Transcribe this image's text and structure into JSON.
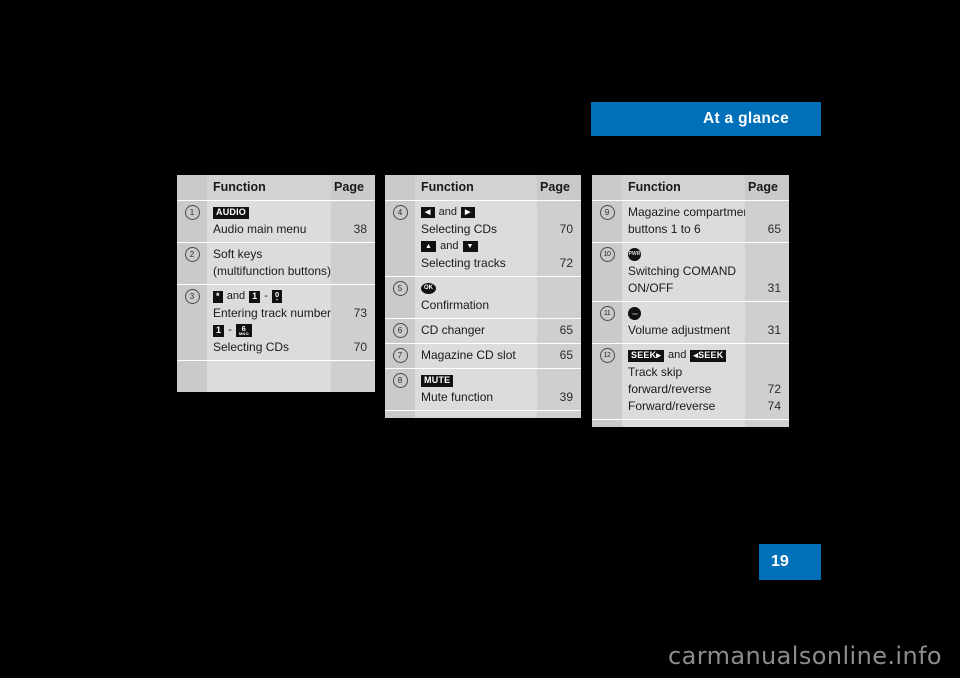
{
  "header": {
    "title": "At a glance",
    "accent_color": "#0070b8"
  },
  "page_marker": {
    "number": "19",
    "accent_color": "#0070b8"
  },
  "watermark": {
    "text": "carmanualsonline.info",
    "color": "#8c8c8c"
  },
  "tables": [
    {
      "head": {
        "function": "Function",
        "page": "Page"
      },
      "rows": [
        {
          "index": "1",
          "lines": [
            {
              "type": "icons",
              "items": [
                {
                  "kind": "key",
                  "text": "AUDIO"
                }
              ]
            },
            {
              "type": "text",
              "text": "Audio main menu"
            }
          ],
          "pages": [
            "",
            "38"
          ]
        },
        {
          "index": "2",
          "lines": [
            {
              "type": "text",
              "text": "Soft keys"
            },
            {
              "type": "text",
              "text": "(multifunction buttons)"
            }
          ],
          "pages": [
            "",
            ""
          ]
        },
        {
          "index": "3",
          "lines": [
            {
              "type": "icons",
              "items": [
                {
                  "kind": "key",
                  "text": "*"
                },
                {
                  "kind": "sep",
                  "text": "and"
                },
                {
                  "kind": "key",
                  "text": "1"
                },
                {
                  "kind": "sep",
                  "text": "-"
                },
                {
                  "kind": "keystack",
                  "main": "0",
                  "sub": "+"
                }
              ]
            },
            {
              "type": "text",
              "text": "Entering track numbers"
            },
            {
              "type": "icons",
              "items": [
                {
                  "kind": "key",
                  "text": "1"
                },
                {
                  "kind": "sep",
                  "text": "-"
                },
                {
                  "kind": "keystack",
                  "main": "6",
                  "sub": "MNO"
                }
              ]
            },
            {
              "type": "text",
              "text": "Selecting CDs"
            }
          ],
          "pages": [
            "",
            "73",
            "",
            "70"
          ]
        }
      ]
    },
    {
      "head": {
        "function": "Function",
        "page": "Page"
      },
      "rows": [
        {
          "index": "4",
          "lines": [
            {
              "type": "icons",
              "items": [
                {
                  "kind": "arrow",
                  "text": "◀"
                },
                {
                  "kind": "sep",
                  "text": "and"
                },
                {
                  "kind": "arrow",
                  "text": "▶"
                }
              ]
            },
            {
              "type": "text",
              "text": "Selecting CDs"
            },
            {
              "type": "icons",
              "items": [
                {
                  "kind": "arrow",
                  "text": "▲"
                },
                {
                  "kind": "sep",
                  "text": "and"
                },
                {
                  "kind": "arrow",
                  "text": "▼"
                }
              ]
            },
            {
              "type": "text",
              "text": "Selecting tracks"
            }
          ],
          "pages": [
            "",
            "70",
            "",
            "72"
          ]
        },
        {
          "index": "5",
          "lines": [
            {
              "type": "icons",
              "items": [
                {
                  "kind": "knob-ok",
                  "text": "OK"
                }
              ]
            },
            {
              "type": "text",
              "text": "Confirmation"
            }
          ],
          "pages": [
            "",
            ""
          ]
        },
        {
          "index": "6",
          "lines": [
            {
              "type": "text",
              "text": "CD changer"
            }
          ],
          "pages": [
            "65"
          ]
        },
        {
          "index": "7",
          "lines": [
            {
              "type": "text",
              "text": "Magazine CD slot"
            }
          ],
          "pages": [
            "65"
          ]
        },
        {
          "index": "8",
          "lines": [
            {
              "type": "icons",
              "items": [
                {
                  "kind": "key",
                  "text": "MUTE"
                }
              ]
            },
            {
              "type": "text",
              "text": "Mute function"
            }
          ],
          "pages": [
            "",
            "39"
          ]
        }
      ]
    },
    {
      "head": {
        "function": "Function",
        "page": "Page"
      },
      "rows": [
        {
          "index": "9",
          "lines": [
            {
              "type": "text",
              "text": "Magazine compartment"
            },
            {
              "type": "text",
              "text": "buttons 1 to 6"
            }
          ],
          "pages": [
            "",
            "65"
          ]
        },
        {
          "index": "10",
          "lines": [
            {
              "type": "icons",
              "items": [
                {
                  "kind": "knob",
                  "text": "PWR"
                }
              ]
            },
            {
              "type": "text",
              "text": "Switching COMAND"
            },
            {
              "type": "text",
              "text": "ON/OFF"
            }
          ],
          "pages": [
            "",
            "",
            "31"
          ]
        },
        {
          "index": "11",
          "lines": [
            {
              "type": "icons",
              "items": [
                {
                  "kind": "knob-blank",
                  "text": ""
                }
              ]
            },
            {
              "type": "text",
              "text": "Volume adjustment"
            }
          ],
          "pages": [
            "",
            "31"
          ]
        },
        {
          "index": "12",
          "lines": [
            {
              "type": "icons",
              "items": [
                {
                  "kind": "key",
                  "text": "SEEK▸"
                },
                {
                  "kind": "sep",
                  "text": "and"
                },
                {
                  "kind": "key",
                  "text": "◂SEEK"
                }
              ]
            },
            {
              "type": "text",
              "text": "Track skip"
            },
            {
              "type": "text",
              "text": "forward/reverse"
            },
            {
              "type": "text",
              "text": "Forward/reverse"
            }
          ],
          "pages": [
            "",
            "",
            "72",
            "74"
          ]
        }
      ]
    }
  ]
}
